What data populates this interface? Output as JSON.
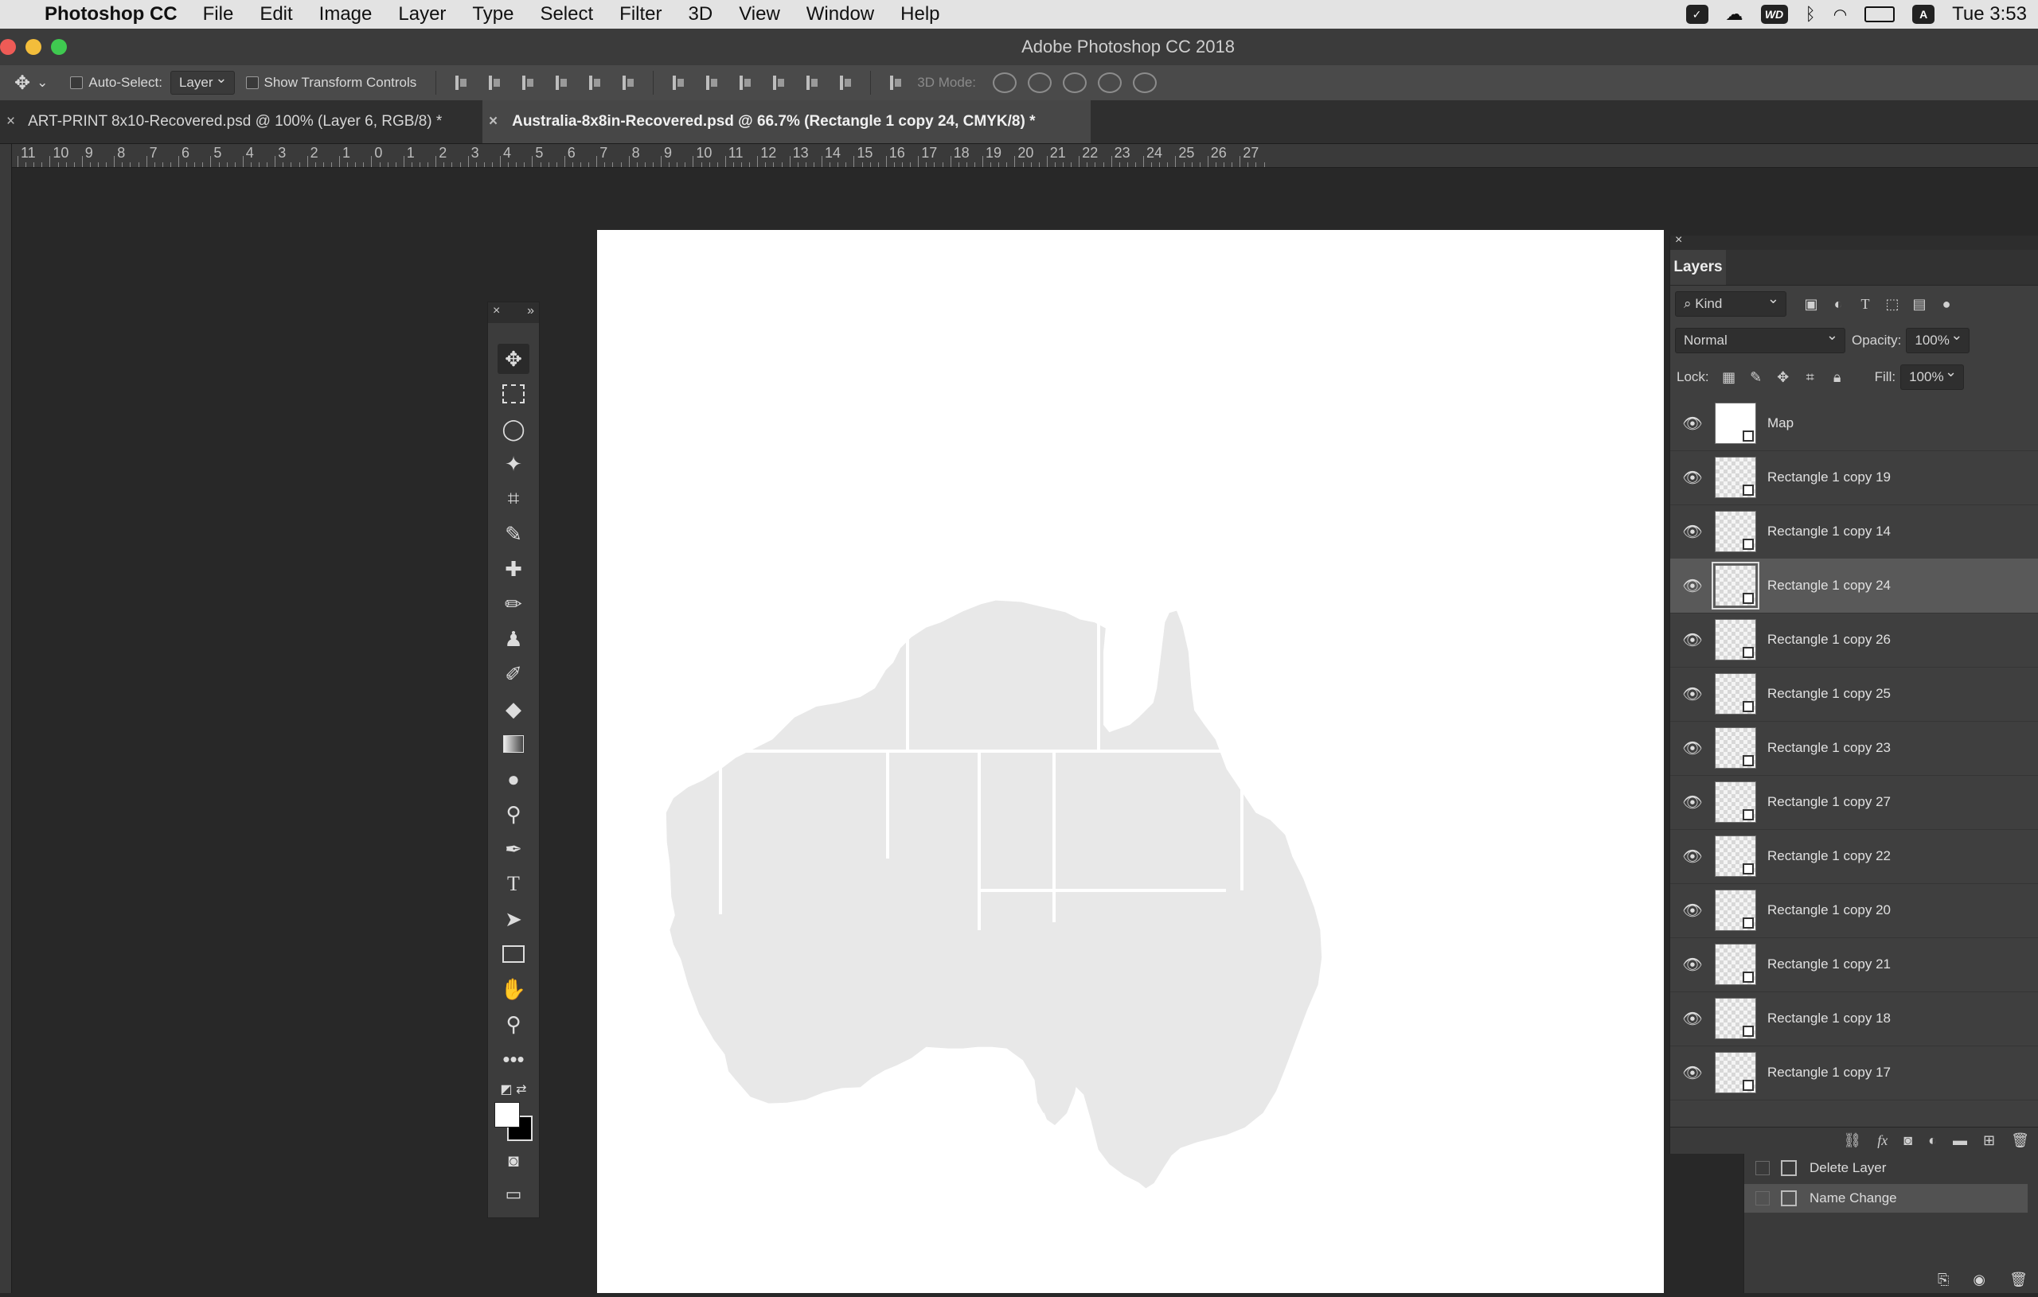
{
  "menubar": {
    "app": "Photoshop CC",
    "items": [
      "File",
      "Edit",
      "Image",
      "Layer",
      "Type",
      "Select",
      "Filter",
      "3D",
      "View",
      "Window",
      "Help"
    ],
    "status_wd": "WD",
    "status_a": "A",
    "clock": "Tue 3:53"
  },
  "window": {
    "title": "Adobe Photoshop CC 2018"
  },
  "options": {
    "auto_select_label": "Auto-Select:",
    "auto_select_value": "Layer",
    "show_transform_label": "Show Transform Controls",
    "mode_3d_label": "3D Mode:"
  },
  "tabs": [
    {
      "label": "ART-PRINT 8x10-Recovered.psd @ 100% (Layer 6, RGB/8) *",
      "active": false
    },
    {
      "label": "Australia-8x8in-Recovered.psd @ 66.7% (Rectangle 1 copy 24, CMYK/8) *",
      "active": true
    }
  ],
  "ruler_labels": [
    "11",
    "10",
    "9",
    "8",
    "7",
    "6",
    "5",
    "4",
    "3",
    "2",
    "1",
    "0",
    "1",
    "2",
    "3",
    "4",
    "5",
    "6",
    "7",
    "8",
    "9",
    "10",
    "11",
    "12",
    "13",
    "14",
    "15",
    "16",
    "17",
    "18",
    "19",
    "20",
    "21",
    "22",
    "23",
    "24",
    "25",
    "26",
    "27"
  ],
  "layers_panel": {
    "tab": "Layers",
    "kind_label": "Kind",
    "blend_mode": "Normal",
    "opacity_label": "Opacity:",
    "opacity_value": "100%",
    "lock_label": "Lock:",
    "fill_label": "Fill:",
    "fill_value": "100%",
    "layers": [
      {
        "name": "Map",
        "selected": false,
        "type": "map"
      },
      {
        "name": "Rectangle 1 copy 19",
        "selected": false,
        "type": "shape"
      },
      {
        "name": "Rectangle 1 copy 14",
        "selected": false,
        "type": "shape"
      },
      {
        "name": "Rectangle 1 copy 24",
        "selected": true,
        "type": "shape"
      },
      {
        "name": "Rectangle 1 copy 26",
        "selected": false,
        "type": "shape"
      },
      {
        "name": "Rectangle 1 copy 25",
        "selected": false,
        "type": "shape"
      },
      {
        "name": "Rectangle 1 copy 23",
        "selected": false,
        "type": "shape"
      },
      {
        "name": "Rectangle 1 copy 27",
        "selected": false,
        "type": "shape"
      },
      {
        "name": "Rectangle 1 copy 22",
        "selected": false,
        "type": "shape"
      },
      {
        "name": "Rectangle 1 copy 20",
        "selected": false,
        "type": "shape"
      },
      {
        "name": "Rectangle 1 copy 21",
        "selected": false,
        "type": "shape"
      },
      {
        "name": "Rectangle 1 copy 18",
        "selected": false,
        "type": "shape"
      },
      {
        "name": "Rectangle 1 copy 17",
        "selected": false,
        "type": "shape"
      }
    ]
  },
  "history_panel": {
    "items": [
      {
        "label": "Delete Layer",
        "selected": false
      },
      {
        "label": "Name Change",
        "selected": true
      }
    ]
  },
  "colors": {
    "foreground": "#ffffff",
    "background": "#000000",
    "map_fill": "#e8e8e8"
  }
}
